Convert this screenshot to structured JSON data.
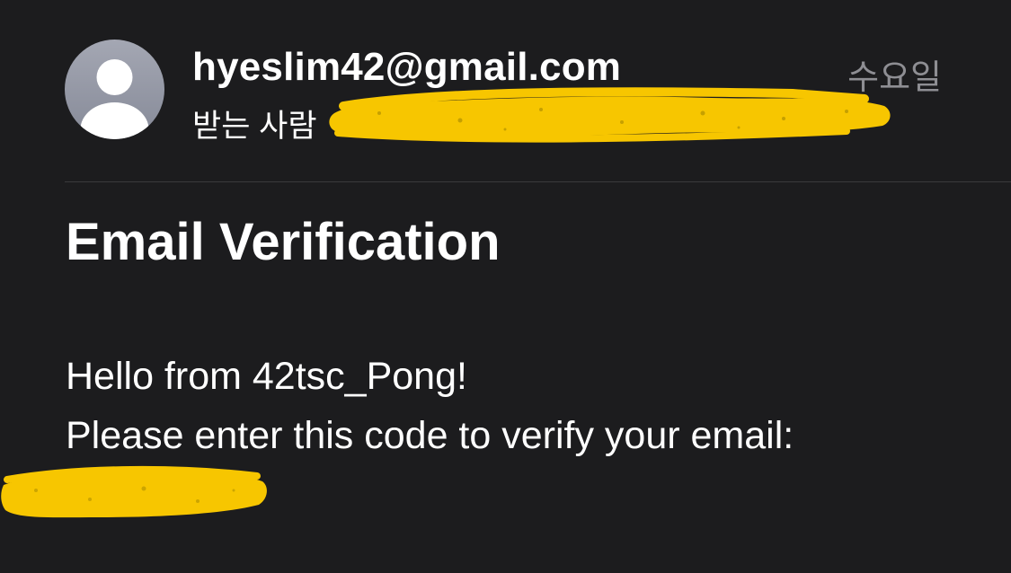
{
  "header": {
    "avatar_icon": "person-placeholder-icon",
    "sender": "hyeslim42@gmail.com",
    "date": "수요일",
    "recipient_label": "받는 사람",
    "redaction_color": "#f7c600"
  },
  "message": {
    "subject": "Email Verification",
    "greeting": "Hello from 42tsc_Pong!",
    "instruction": "Please enter this code to verify your email:"
  },
  "colors": {
    "background": "#1c1c1e",
    "text": "#ffffff",
    "secondary_text": "#8e8e93",
    "divider": "#3a3a3c",
    "highlight": "#f7c600"
  }
}
